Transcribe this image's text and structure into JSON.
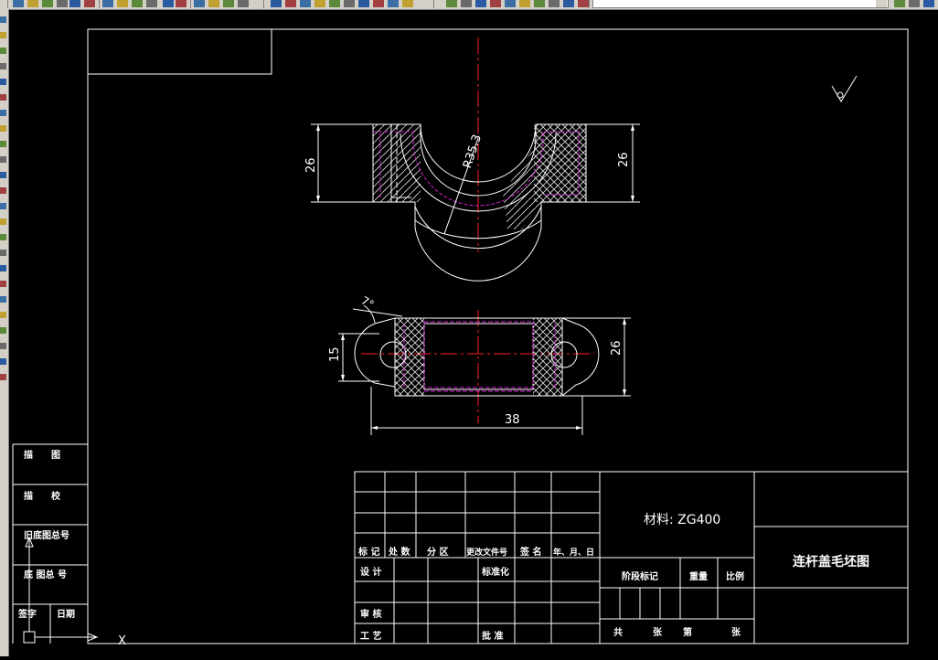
{
  "app": {
    "toolbar_buttons": [
      "new-icon",
      "open-icon",
      "save-icon",
      "print-icon",
      "plot-preview-icon",
      "publish-icon",
      "cut-icon",
      "copy-icon",
      "paste-icon",
      "match-properties-icon",
      "undo-icon",
      "redo-icon",
      "pan-icon",
      "zoom-realtime-icon",
      "zoom-window-icon",
      "zoom-previous-icon",
      "properties-icon",
      "design-center-icon",
      "tool-palettes-icon",
      "sheet-set-icon",
      "markup-icon",
      "quickcalc-icon",
      "help-icon",
      "layer-manager-icon",
      "layer-state-icon",
      "layer-previous-icon"
    ],
    "left_tools": [
      "line-icon",
      "polyline-icon",
      "arc-icon",
      "circle-icon",
      "rectangle-icon",
      "hatch-icon",
      "text-icon",
      "insert-block-icon"
    ]
  },
  "drawing": {
    "surface_finish_symbol": "roughness-symbol",
    "top_view": {
      "dim_left": "26",
      "dim_right": "26",
      "radius_label": "R35.3"
    },
    "front_view": {
      "dim_left": "15",
      "dim_right": "26",
      "dim_bottom": "38",
      "angle_label": "7°"
    },
    "left_block": {
      "rows": [
        "描　　图",
        "描　　校",
        "旧底图总号",
        "底 图总 号",
        "签字",
        "日期"
      ]
    },
    "title_block": {
      "rev_headers": [
        "标 记",
        "处 数",
        "分 区",
        "更改文件号",
        "签 名",
        "年、月、日"
      ],
      "sign_labels": [
        "设 计",
        "标准化",
        "审 核",
        "工 艺",
        "批 准"
      ],
      "material": "材料: ZG400",
      "stage_mark": "阶段标记",
      "weight": "重量",
      "scale": "比例",
      "sheets": [
        "共",
        "张",
        "第",
        "张"
      ],
      "title": "连杆盖毛坯图"
    },
    "ucs": {
      "x_label": "X"
    }
  }
}
